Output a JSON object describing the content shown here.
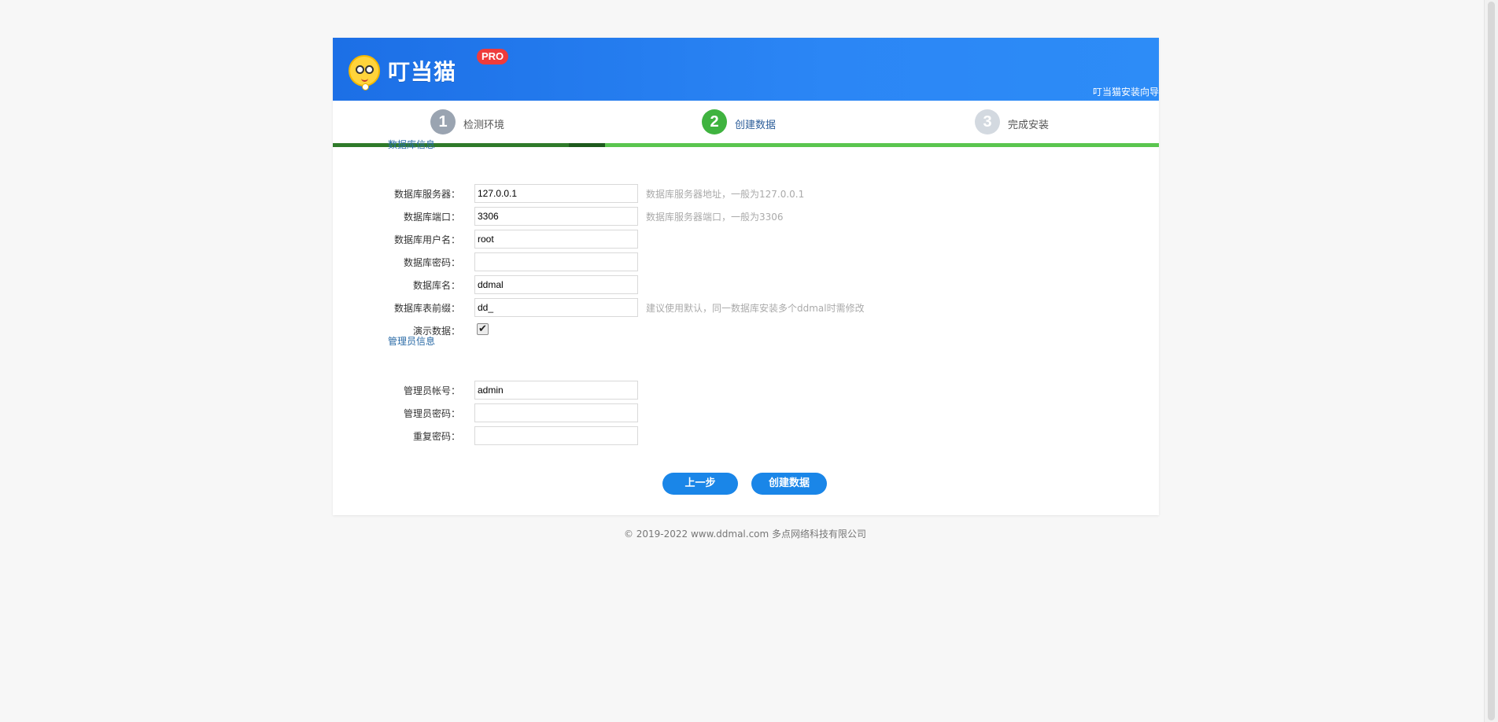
{
  "header": {
    "brand": "叮当猫",
    "badge": "PRO",
    "wizard_title": "叮当猫安装向导",
    "brand_color": "#1e74ea"
  },
  "steps": [
    {
      "number": "1",
      "label": "检测环境",
      "status": "done"
    },
    {
      "number": "2",
      "label": "创建数据",
      "status": "active"
    },
    {
      "number": "3",
      "label": "完成安装",
      "status": "pending"
    }
  ],
  "db_section": {
    "title": "数据库信息",
    "fields": {
      "server": {
        "label": "数据库服务器：",
        "value": "127.0.0.1",
        "hint": "数据库服务器地址，一般为127.0.0.1"
      },
      "port": {
        "label": "数据库端口：",
        "value": "3306",
        "hint": "数据库服务器端口，一般为3306"
      },
      "user": {
        "label": "数据库用户名：",
        "value": "root",
        "hint": ""
      },
      "password": {
        "label": "数据库密码：",
        "value": "",
        "hint": ""
      },
      "name": {
        "label": "数据库名：",
        "value": "ddmal",
        "hint": ""
      },
      "prefix": {
        "label": "数据库表前缀：",
        "value": "dd_",
        "hint": "建议使用默认，同一数据库安装多个ddmal时需修改"
      },
      "demo": {
        "label": "演示数据：",
        "checked": true
      }
    }
  },
  "admin_section": {
    "title": "管理员信息",
    "fields": {
      "account": {
        "label": "管理员帐号：",
        "value": "admin"
      },
      "password": {
        "label": "管理员密码：",
        "value": ""
      },
      "repeat": {
        "label": "重复密码：",
        "value": ""
      }
    }
  },
  "buttons": {
    "prev": "上一步",
    "create": "创建数据",
    "color": "#1a86e8"
  },
  "footer": {
    "copyright": "© 2019-2022 www.ddmal.com 多点网络科技有限公司"
  }
}
